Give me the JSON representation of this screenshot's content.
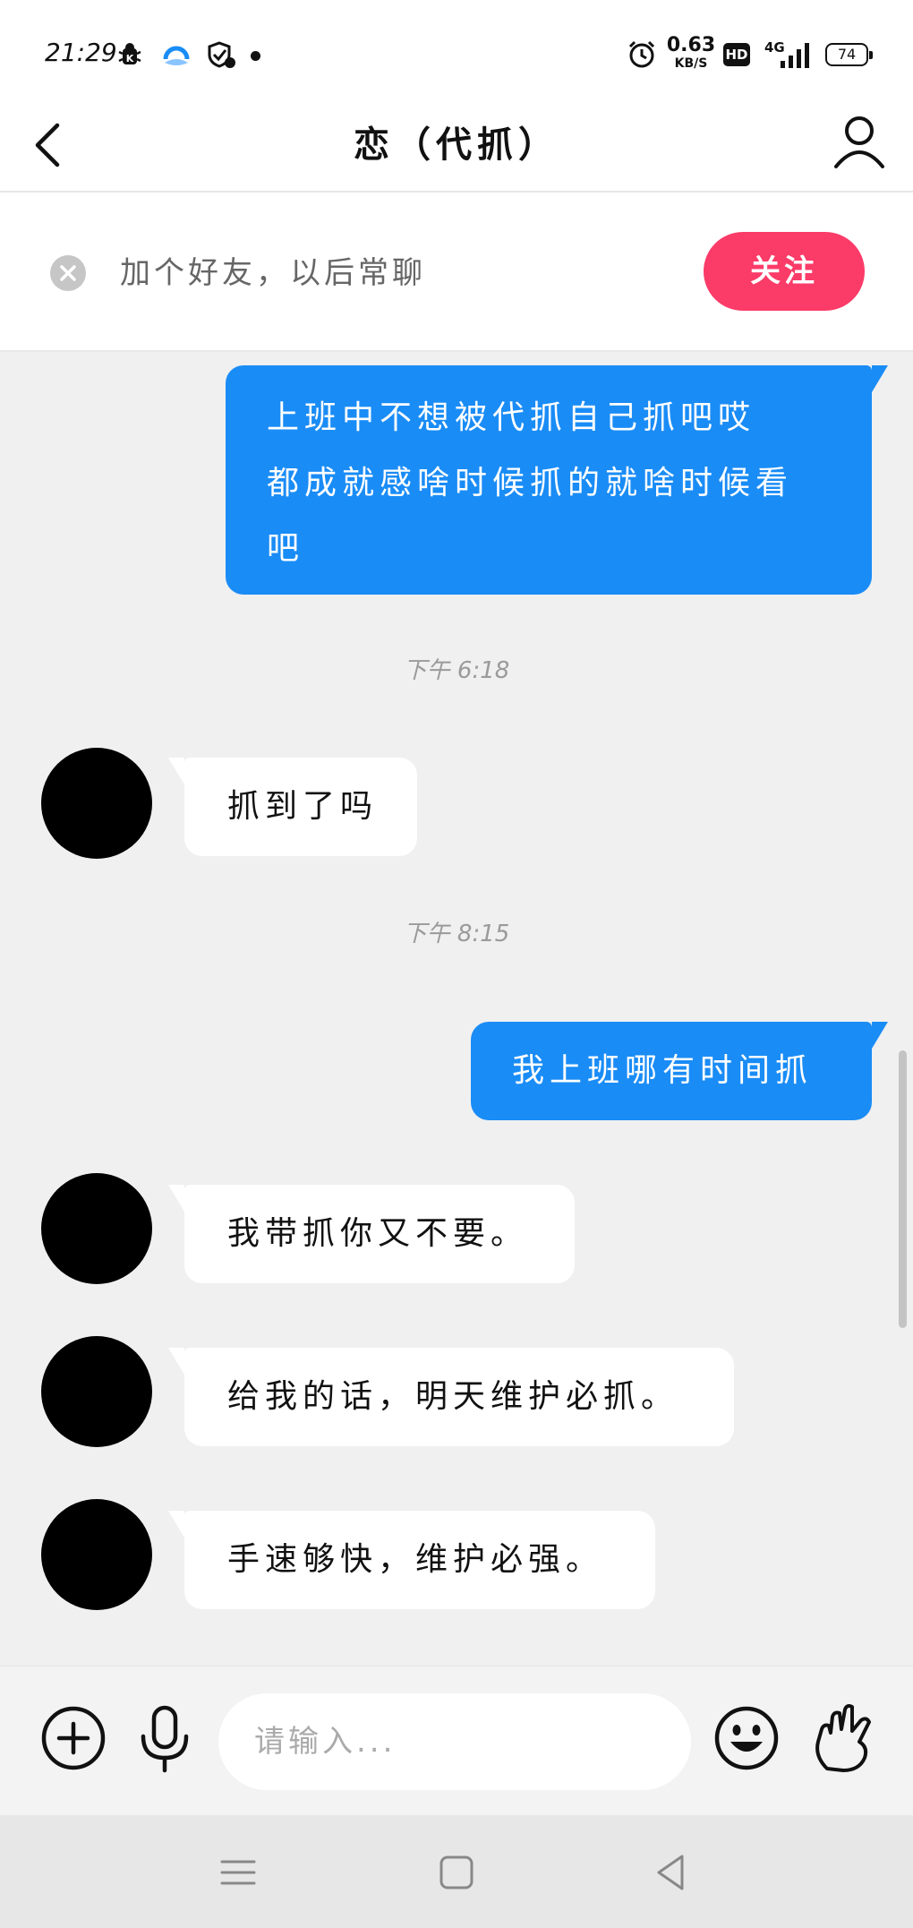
{
  "status_bar": {
    "time": "21:29",
    "net_speed_value": "0.63",
    "net_speed_unit": "KB/S",
    "hd_label": "HD",
    "network_label": "4G",
    "battery_level": "74",
    "icons": [
      "bug-icon",
      "browser-icon",
      "shield-icon",
      "notification-dot",
      "alarm-icon",
      "hd-icon",
      "signal-icon",
      "battery-icon"
    ]
  },
  "header": {
    "title": "恋（代抓）",
    "back_icon": "chevron-left-icon",
    "profile_icon": "user-icon"
  },
  "follow_banner": {
    "text": "加个好友，以后常聊",
    "button_label": "关注",
    "button_color": "#fb3b68",
    "dismiss_icon": "close-circle-icon"
  },
  "messages": [
    {
      "direction": "outgoing",
      "lines": [
        "上班中不想被代抓自己抓吧哎",
        "都成就感啥时候抓的就啥时候看",
        "吧"
      ]
    },
    {
      "type": "timestamp",
      "text": "下午 6:18"
    },
    {
      "direction": "incoming",
      "text": "抓到了吗"
    },
    {
      "type": "timestamp",
      "text": "下午 8:15"
    },
    {
      "direction": "outgoing",
      "text": "我上班哪有时间抓"
    },
    {
      "direction": "incoming",
      "text": "我带抓你又不要。"
    },
    {
      "direction": "incoming",
      "text": "给我的话，明天维护必抓。"
    },
    {
      "direction": "incoming",
      "text": "手速够快，维护必强。"
    }
  ],
  "input_bar": {
    "placeholder": "请输入...",
    "icons": [
      "add-icon",
      "microphone-icon",
      "emoji-icon",
      "gesture-hand-icon"
    ]
  },
  "nav_bar": {
    "icons": [
      "menu-icon",
      "home-icon",
      "back-triangle-icon"
    ]
  },
  "colors": {
    "outgoing_bubble": "#1a8cf6",
    "incoming_bubble": "#ffffff",
    "chat_background": "#f0f0f0"
  }
}
